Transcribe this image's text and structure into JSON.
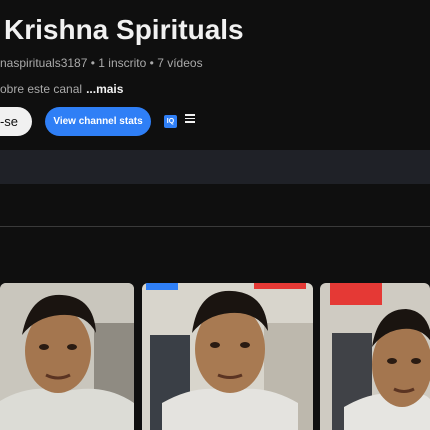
{
  "channel": {
    "title": "Krishna Spirituals",
    "handle": "naspirituals3187",
    "subscribers": "1 inscrito",
    "videos": "7 vídeos",
    "description_start": "obre este canal",
    "more_label": "...mais"
  },
  "actions": {
    "subscribe_label": "r-se",
    "stats_label": "View channel stats",
    "extension_icon_label": "IQ"
  },
  "colors": {
    "background": "#0f0f0f",
    "accent": "#2f7ff6",
    "subscribe_bg": "#f1f1f1"
  },
  "videos": [
    {
      "thumbnail": "person-face-video-1"
    },
    {
      "thumbnail": "person-face-video-2"
    },
    {
      "thumbnail": "person-face-video-3"
    }
  ]
}
